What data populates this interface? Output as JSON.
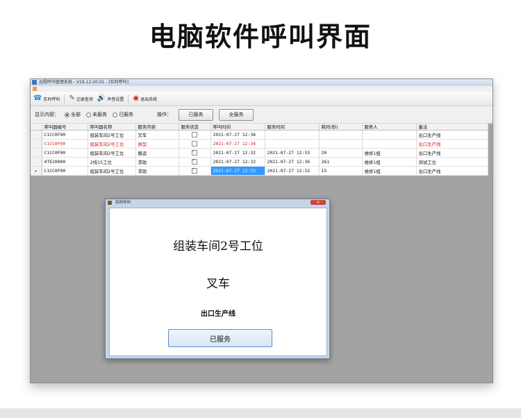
{
  "page": {
    "title": "电脑软件呼叫界面"
  },
  "window": {
    "title": "远程呼叫管理系统 - V19.12.20.01 - [实时呼叫]"
  },
  "toolbar": {
    "realtime_call": "实时呼叫",
    "log_query": "记录查询",
    "sound_settings": "声音设置",
    "exit_system": "退出系统"
  },
  "filter": {
    "label": "显示内容：",
    "options": [
      "全部",
      "未服务",
      "已服务"
    ],
    "selected": "全部",
    "op_label": "操作：",
    "btn_served": "已服务",
    "btn_all_served": "全服务"
  },
  "table": {
    "headers": [
      "呼叫器编号",
      "呼叫器名称",
      "服务内容",
      "服务状态",
      "呼叫时间",
      "服务时间",
      "耗时(秒)",
      "服务人",
      "备注"
    ],
    "rows": [
      {
        "id": "C1CC0F00",
        "name": "组装车间2号工位",
        "content": "叉车",
        "status_checked": false,
        "call_time": "2021-07-27 12:36",
        "service_time": "",
        "duration": "",
        "server": "",
        "note": "出口生产线"
      },
      {
        "id": "C1CC0F00",
        "name": "组装车间2号工位",
        "content": "换型",
        "status_checked": false,
        "call_time": "2021-07-27 12:34",
        "service_time": "",
        "duration": "",
        "server": "",
        "note": "出口生产线"
      },
      {
        "id": "C1CC0F00",
        "name": "组装车间2号工位",
        "content": "搬运",
        "status_checked": true,
        "call_time": "2021-07-27 12:32",
        "service_time": "2021-07-27 12:33",
        "duration": "20",
        "server": "维修1组",
        "note": "出口生产线"
      },
      {
        "id": "4TE20800",
        "name": "2线15工位",
        "content": "求助",
        "status_checked": true,
        "call_time": "2021-07-27 12:32",
        "service_time": "2021-07-27 12:36",
        "duration": "261",
        "server": "维修1组",
        "note": "测试工位"
      },
      {
        "id": "C1CC0F00",
        "name": "组装车间2号工位",
        "content": "求助",
        "status_checked": true,
        "call_time": "2021-07-27 12:32",
        "service_time": "2021-07-27 12:32",
        "duration": "15",
        "server": "维修1组",
        "note": "出口生产线"
      }
    ],
    "highlight_row_color": "#d42020",
    "selected_cell_color": "#3399ff"
  },
  "dialog": {
    "title": "实时呼叫",
    "close_icon": "×",
    "station": "组装车间2号工位",
    "service": "叉车",
    "line": "出口生产线",
    "button": "已服务"
  }
}
